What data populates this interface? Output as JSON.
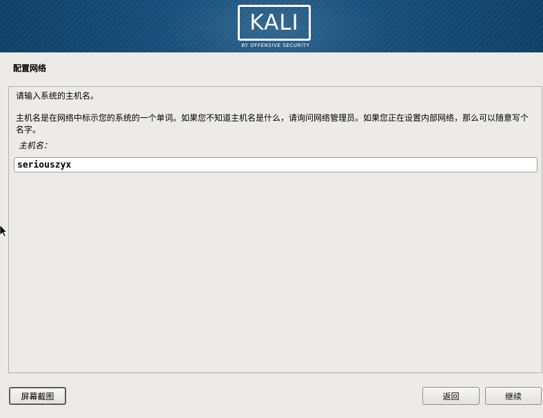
{
  "banner": {
    "logo_text": "KALI",
    "logo_subtitle": "BY OFFENSIVE SECURITY"
  },
  "page": {
    "title": "配置网络"
  },
  "content": {
    "intro": "请输入系统的主机名。",
    "description": "主机名是在网络中标示您的系统的一个单词。如果您不知道主机名是什么，请询问网络管理员。如果您正在设置内部网络，那么可以随意写个名字。",
    "hostname_label": "主机名：",
    "hostname_value": "seriouszyx"
  },
  "buttons": {
    "screenshot": "屏幕截图",
    "back": "返回",
    "continue": "继续"
  },
  "colors": {
    "banner": "#1b5582",
    "background": "#edebe8"
  }
}
